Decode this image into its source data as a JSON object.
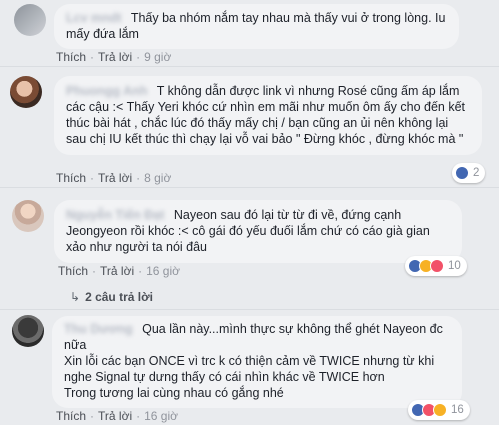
{
  "comments": [
    {
      "author": "Lcv mndt",
      "text": "Thấy ba nhóm nắm tay nhau mà thấy vui ở trong lòng. Iu mấy đứa lắm",
      "like": "Thích",
      "reply": "Trả lời",
      "time": "9 giờ"
    },
    {
      "author": "Phuongg Anh",
      "text": "T không dẫn được link vì nhưng Rosé cũng ấm áp lắm các cậu :< Thấy Yeri khóc cứ nhìn em mãi như muốn ôm ấy cho đến kết thúc bài hát , chắc lúc đó thấy mấy chị / bạn cũng an ủi nên không lại sau chị IU kết thúc thì chạy lại vỗ vai bảo \" Đừng khóc , đừng khóc mà \"",
      "like": "Thích",
      "reply": "Trả lời",
      "time": "8 giờ",
      "reactions": {
        "count": "2"
      }
    },
    {
      "author": "Nguyễn Tiến Đạt",
      "text": "Nayeon sau đó lại từ từ đi về, đứng cạnh Jeongyeon rồi khóc :< cô gái đó yếu đuối lắm chứ có cáo già gian xảo như người ta nói đâu",
      "like": "Thích",
      "reply": "Trả lời",
      "time": "16 giờ",
      "reactions": {
        "count": "10"
      },
      "replies": "2 câu trả lời"
    },
    {
      "author": "Thu Dương",
      "text": "Qua lần này...mình thực sự không thể ghét Nayeon đc nữa\nXin lỗi các bạn ONCE vì trc k có thiện cảm về TWICE nhưng từ khi nghe Signal tự dưng thấy có cái nhìn khác về TWICE hơn\nTrong tương lai cùng nhau có gắng nhé",
      "like": "Thích",
      "reply": "Trả lời",
      "time": "16 giờ",
      "reactions": {
        "count": "16"
      }
    }
  ],
  "separator": "·"
}
